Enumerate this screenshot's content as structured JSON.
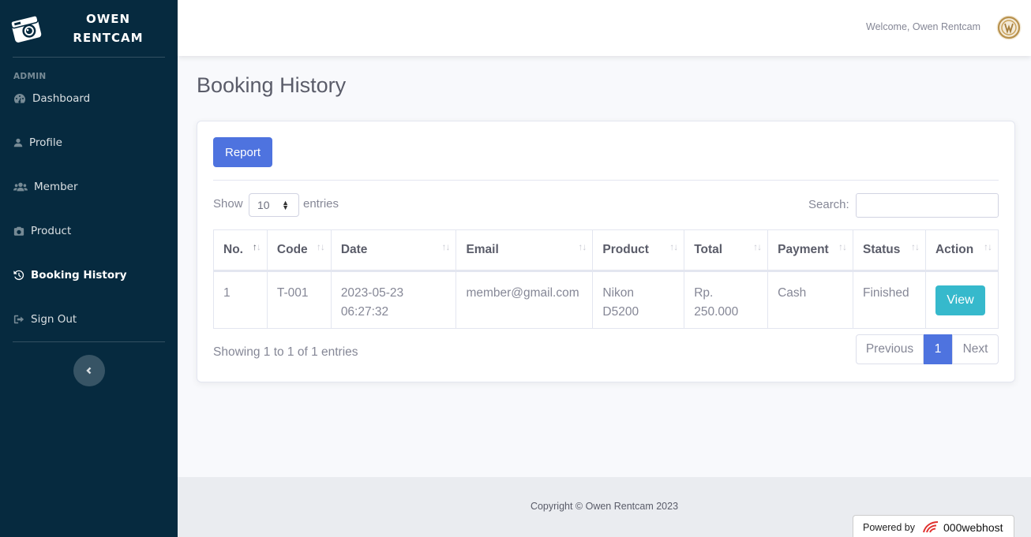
{
  "brand": {
    "line1": "OWEN",
    "line2": "RENTCAM"
  },
  "sidebar": {
    "heading": "ADMIN",
    "items": [
      {
        "label": "Dashboard",
        "icon": "tachometer-icon"
      },
      {
        "label": "Profile",
        "icon": "user-icon"
      },
      {
        "label": "Member",
        "icon": "users-icon"
      },
      {
        "label": "Product",
        "icon": "camera-icon"
      },
      {
        "label": "Booking History",
        "icon": "history-icon",
        "active": true
      },
      {
        "label": "Sign Out",
        "icon": "sign-out-icon"
      }
    ]
  },
  "topbar": {
    "welcome": "Welcome, Owen Rentcam"
  },
  "page": {
    "title": "Booking History"
  },
  "card": {
    "report_label": "Report",
    "show_label": "Show",
    "entries_value": "10",
    "entries_label": "entries",
    "search_label": "Search:",
    "search_value": ""
  },
  "table": {
    "columns": [
      "No.",
      "Code",
      "Date",
      "Email",
      "Product",
      "Total",
      "Payment",
      "Status",
      "Action"
    ],
    "rows": [
      {
        "no": "1",
        "code": "T-001",
        "date_line1": "2023-05-23",
        "date_line2": "06:27:32",
        "email": "member@gmail.com",
        "product_line1": "Nikon",
        "product_line2": "D5200",
        "total_line1": "Rp.",
        "total_line2": "250.000",
        "payment": "Cash",
        "status": "Finished",
        "action": "View"
      }
    ]
  },
  "info": "Showing 1 to 1 of 1 entries",
  "pagination": {
    "previous": "Previous",
    "current": "1",
    "next": "Next"
  },
  "footer": {
    "copyright": "Copyright © Owen Rentcam 2023",
    "powered_by": "Powered by",
    "host": "000webhost"
  },
  "colors": {
    "sidebar_bg": "#062a3f",
    "primary": "#4e73df",
    "info": "#36b9cc",
    "footer_bg": "#eaecf0"
  }
}
